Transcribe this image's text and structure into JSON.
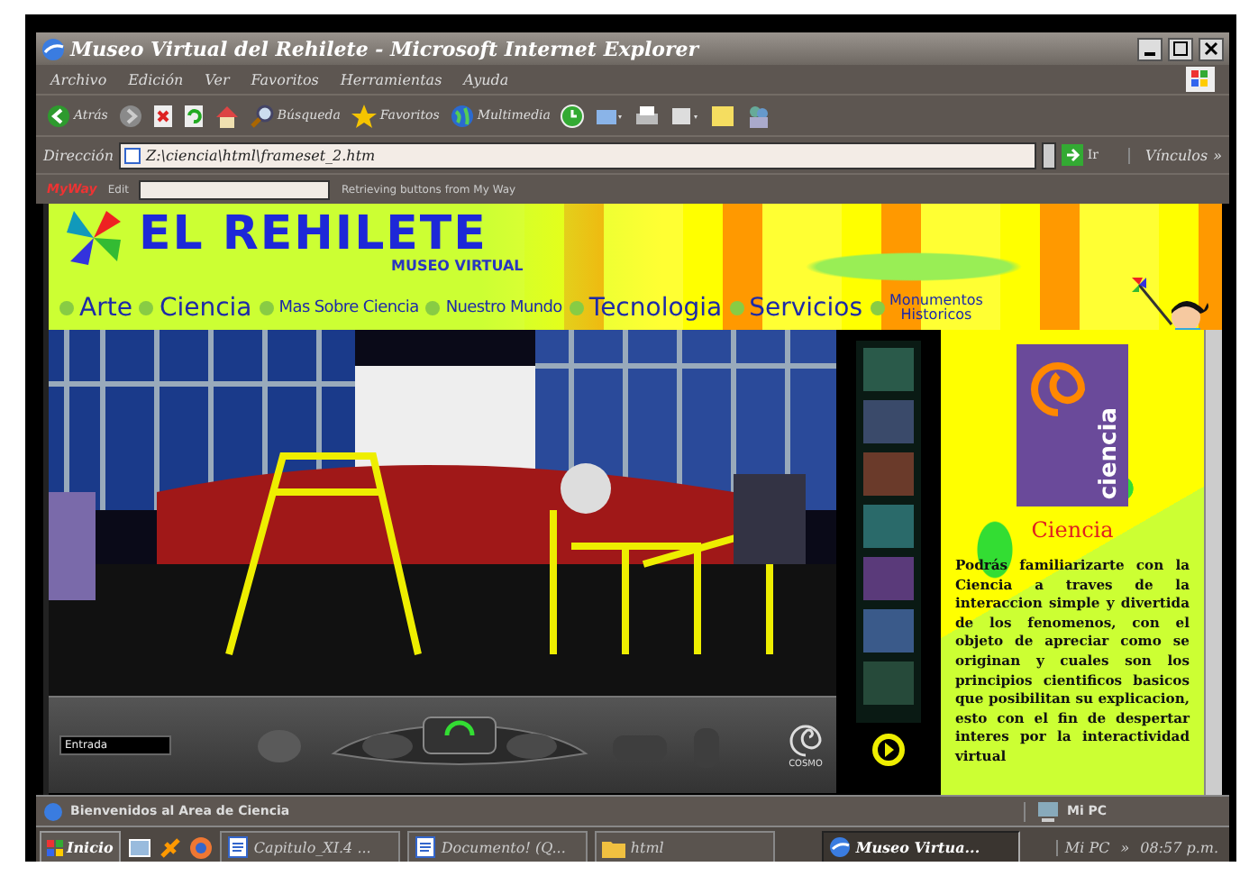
{
  "window": {
    "title": "Museo Virtual del Rehilete - Microsoft Internet Explorer"
  },
  "menu": [
    "Archivo",
    "Edición",
    "Ver",
    "Favoritos",
    "Herramientas",
    "Ayuda"
  ],
  "toolbar": [
    {
      "kind": "back",
      "label": "Atrás"
    },
    {
      "kind": "forward"
    },
    {
      "kind": "stop"
    },
    {
      "kind": "refresh"
    },
    {
      "kind": "home"
    },
    {
      "kind": "search",
      "label": "Búsqueda"
    },
    {
      "kind": "favorites",
      "label": "Favoritos"
    },
    {
      "kind": "media",
      "label": "Multimedia"
    },
    {
      "kind": "history"
    },
    {
      "kind": "mail"
    },
    {
      "kind": "print"
    },
    {
      "kind": "edit"
    },
    {
      "kind": "folder"
    },
    {
      "kind": "messenger"
    }
  ],
  "address": {
    "label": "Dirección",
    "value": "Z:\\ciencia\\html\\frameset_2.htm",
    "go": "Ir",
    "links": "Vínculos",
    "links_more": "»"
  },
  "myway": {
    "logo": "MyWay",
    "edit": "Edit",
    "status": "Retrieving buttons from My Way"
  },
  "site": {
    "logo": "EL REHILETE",
    "subtitle": "MUSEO VIRTUAL",
    "nav": [
      {
        "label": "Arte"
      },
      {
        "label": "Ciencia"
      },
      {
        "label": "Mas Sobre Ciencia"
      },
      {
        "label": "Nuestro Mundo"
      },
      {
        "label": "Tecnologia"
      },
      {
        "label": "Servicios"
      },
      {
        "label": "Monumentos Historicos"
      }
    ],
    "viewer": {
      "field": "Entrada",
      "brand": "COSMO"
    },
    "panel": {
      "image_label": "ciencia",
      "heading": "Ciencia",
      "text": "Podrás familiarizarte con la Ciencia a traves de la interaccion simple y divertida de los fenomenos, con el objeto de apreciar como se originan y cuales son los principios cientificos basicos que posibilitan su explicacion, esto con el fin de despertar interes por la interactividad virtual"
    }
  },
  "status_bar": {
    "text": "Bienvenidos al Area de Ciencia",
    "zone": "Mi PC"
  },
  "taskbar": {
    "start": "Inicio",
    "items": [
      {
        "kind": "document",
        "label": "Capitulo_XI.4 ...",
        "selected": false
      },
      {
        "kind": "document",
        "label": "Documento! (Q...",
        "selected": false
      },
      {
        "kind": "folder",
        "label": "html",
        "selected": false
      },
      {
        "kind": "browser",
        "label": "Museo Virtua...",
        "selected": true
      }
    ],
    "tray": "Mi PC",
    "tray_more": "»",
    "clock": "08:57 p.m."
  }
}
